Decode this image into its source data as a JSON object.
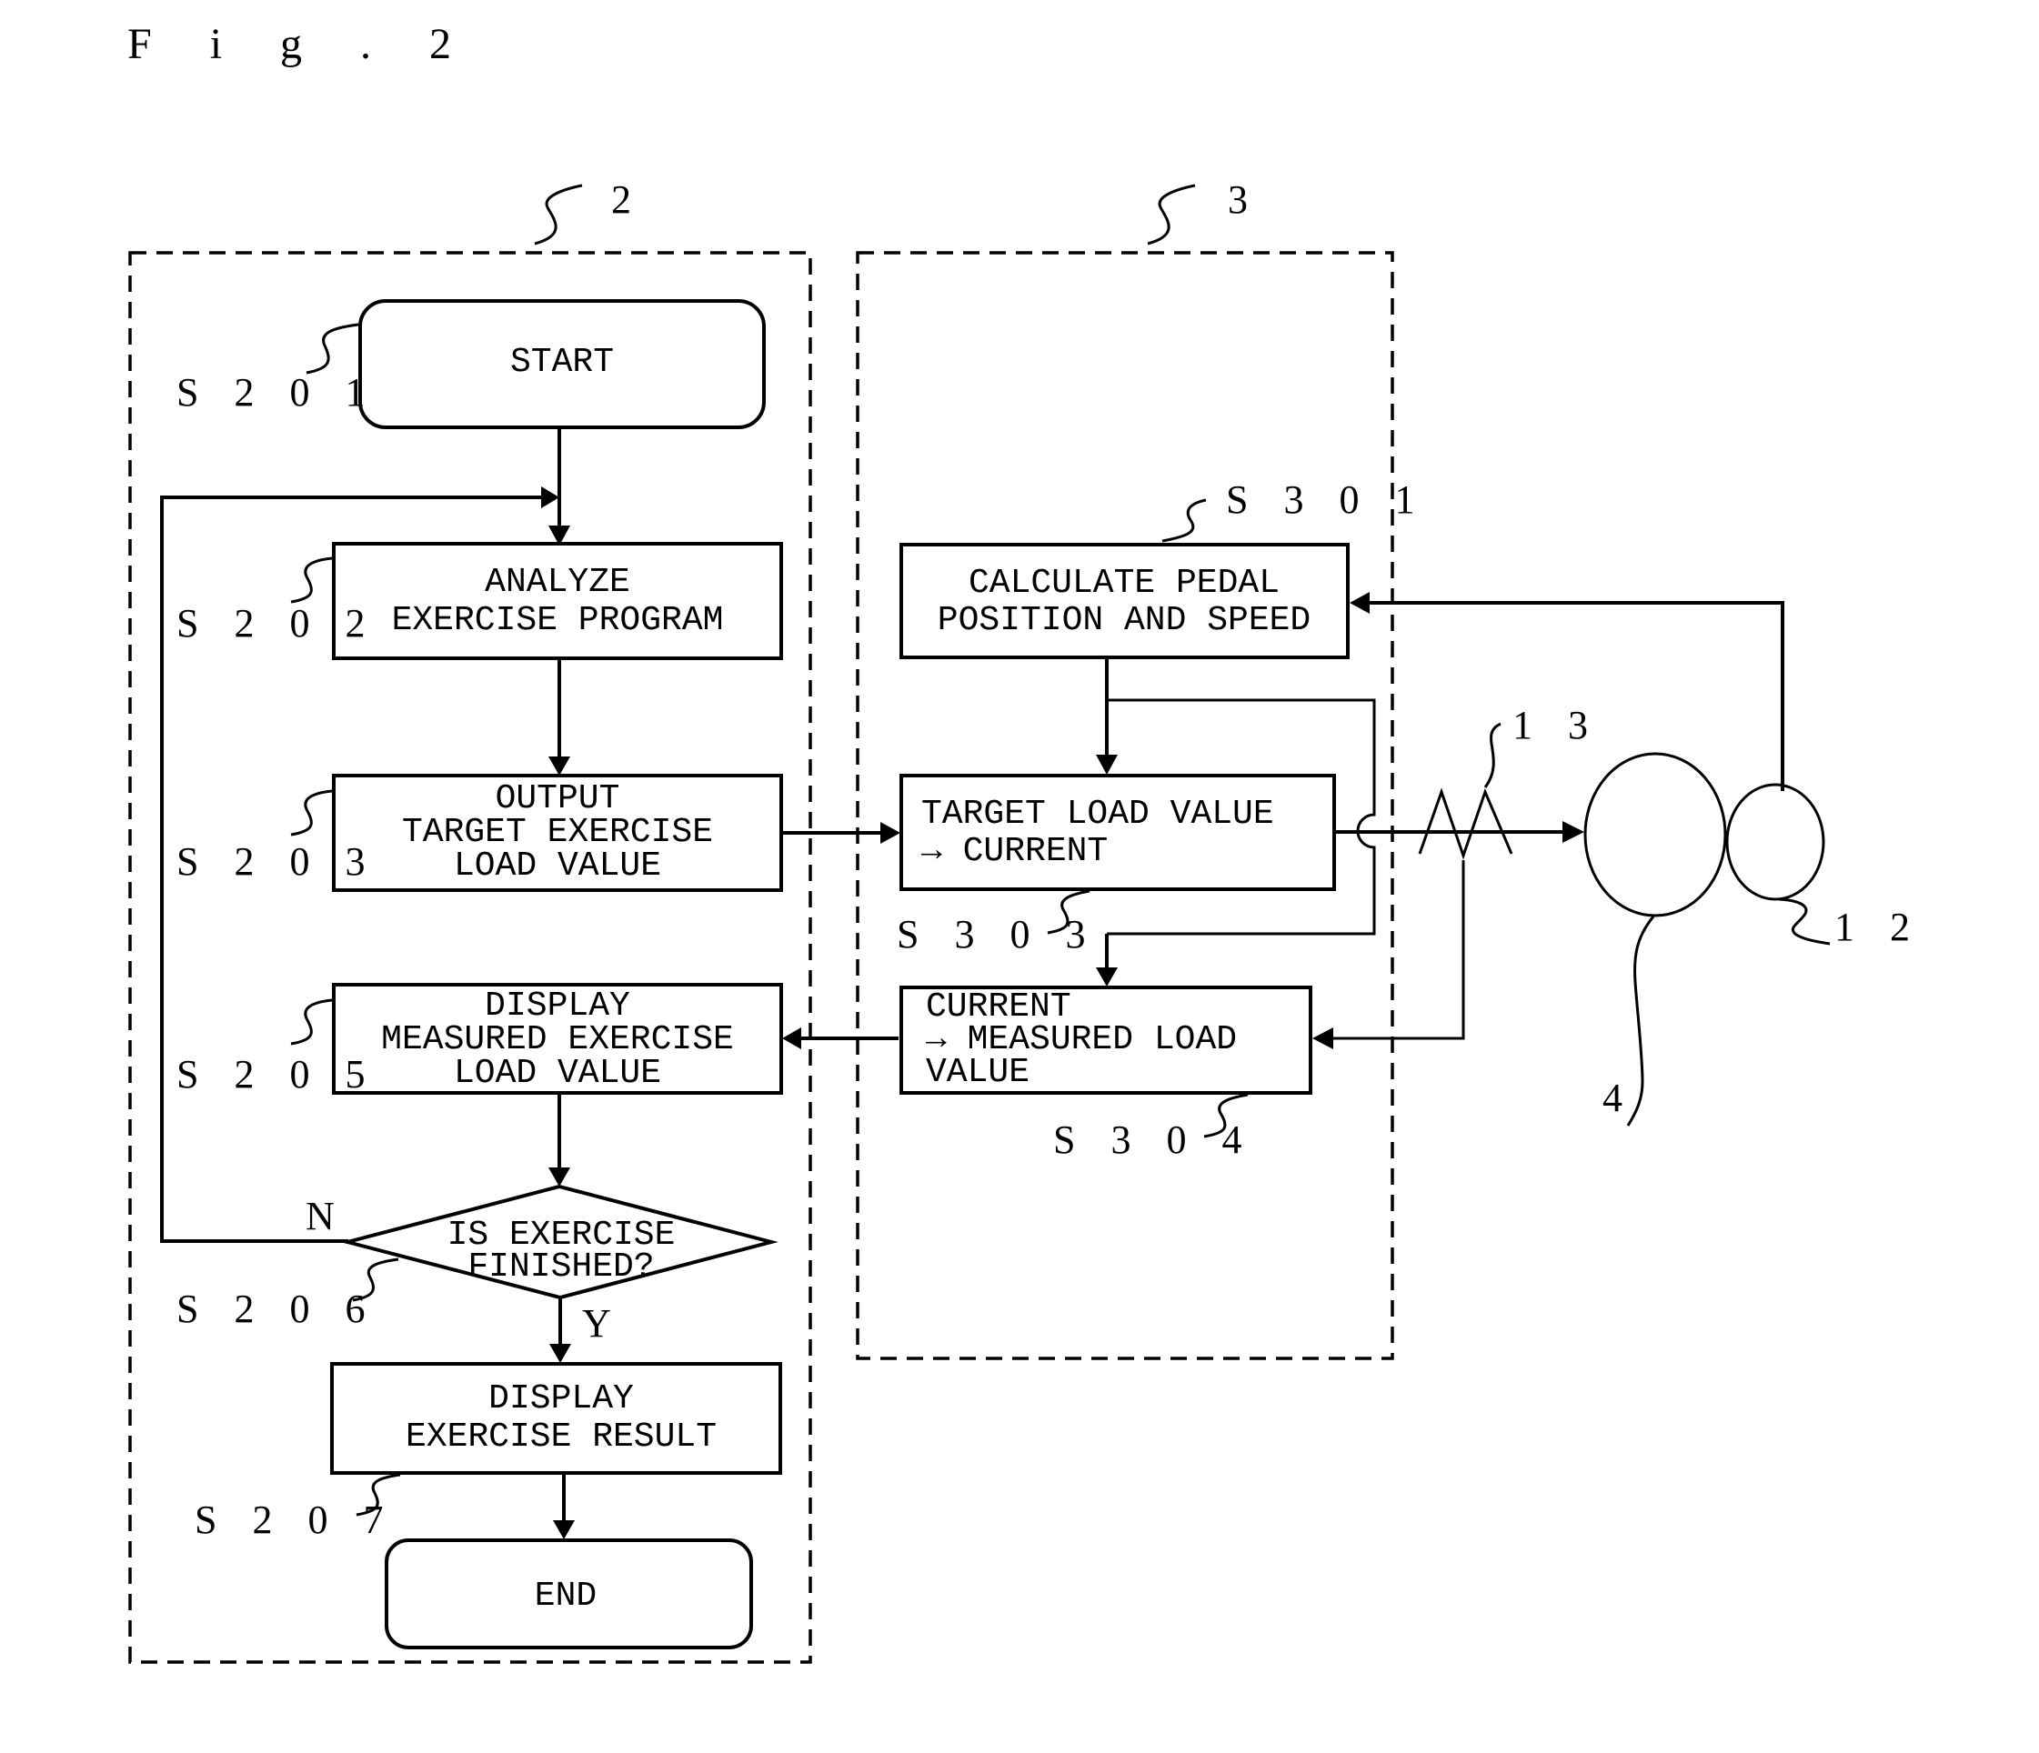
{
  "figure": {
    "title": "F i g . 2",
    "group_labels": {
      "controller": "2",
      "load_unit": "3"
    },
    "component_labels": {
      "resistor": "1 3",
      "motor": "4",
      "sensor": "1 2"
    }
  },
  "flow_left": {
    "start": {
      "ref": "S 2 0 1",
      "lines": [
        "START"
      ]
    },
    "analyze": {
      "ref": "S 2 0 2",
      "lines": [
        "ANALYZE",
        "EXERCISE PROGRAM"
      ]
    },
    "output_target": {
      "ref": "S 2 0 3",
      "lines": [
        "OUTPUT",
        "TARGET EXERCISE",
        "LOAD VALUE"
      ]
    },
    "display_measured": {
      "ref": "S 2 0 5",
      "lines": [
        "DISPLAY",
        "MEASURED EXERCISE",
        "LOAD VALUE"
      ]
    },
    "decision": {
      "ref": "S 2 0 6",
      "lines": [
        "IS EXERCISE",
        "FINISHED?"
      ],
      "no_label": "N",
      "yes_label": "Y"
    },
    "display_result": {
      "ref": "S 2 0 7",
      "lines": [
        "DISPLAY",
        "EXERCISE RESULT"
      ]
    },
    "end": {
      "lines": [
        "END"
      ]
    }
  },
  "flow_right": {
    "calc_pedal": {
      "ref": "S 3 0 1",
      "lines": [
        "CALCULATE PEDAL",
        "POSITION AND SPEED"
      ]
    },
    "target_to_current": {
      "ref": "S 3 0 3",
      "lines": [
        "TARGET LOAD VALUE",
        "→ CURRENT"
      ]
    },
    "current_to_measured": {
      "ref": "S 3 0 4",
      "lines": [
        "CURRENT",
        "→ MEASURED LOAD",
        "VALUE"
      ]
    }
  }
}
